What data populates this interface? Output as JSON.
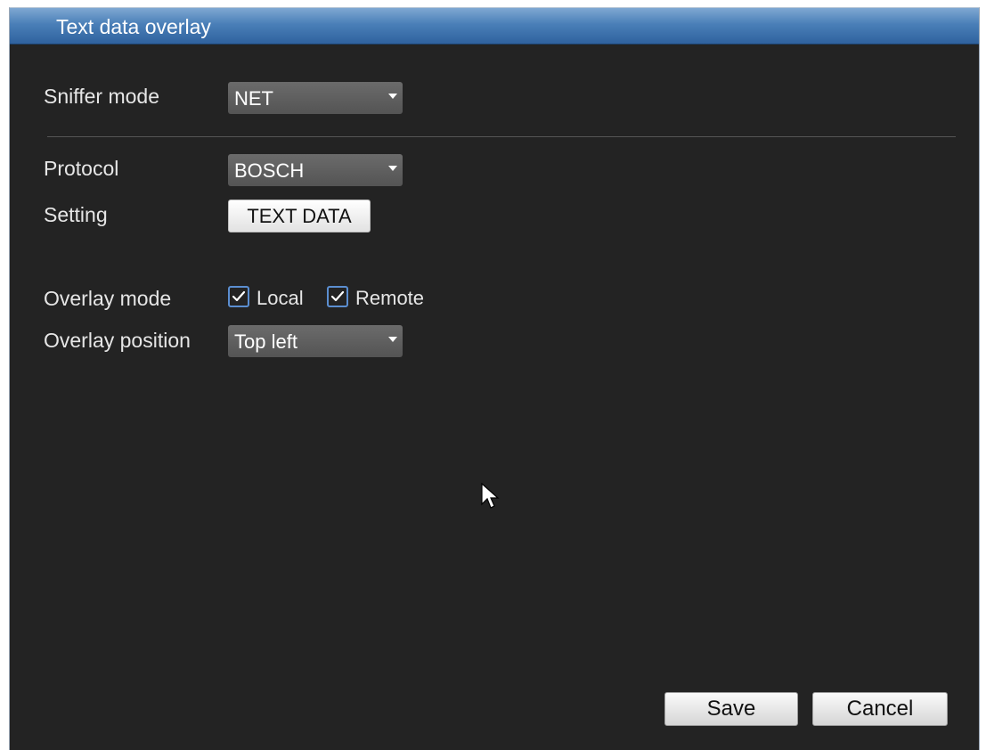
{
  "window": {
    "title": "Text data overlay"
  },
  "sniffer_mode": {
    "label": "Sniffer mode",
    "value": "NET"
  },
  "protocol": {
    "label": "Protocol",
    "value": "BOSCH"
  },
  "setting": {
    "label": "Setting",
    "button_label": "TEXT DATA"
  },
  "overlay_mode": {
    "label": "Overlay mode",
    "local_label": "Local",
    "local_checked": true,
    "remote_label": "Remote",
    "remote_checked": true
  },
  "overlay_position": {
    "label": "Overlay position",
    "value": "Top left"
  },
  "footer": {
    "save_label": "Save",
    "cancel_label": "Cancel"
  },
  "icons": {
    "dropdown": "chevron-down-icon",
    "check": "checkmark-icon",
    "cursor": "mouse-pointer-icon"
  },
  "colors": {
    "title_bar": "#3a6ea8",
    "background": "#232323",
    "checkbox_border": "#5b8ed0"
  }
}
